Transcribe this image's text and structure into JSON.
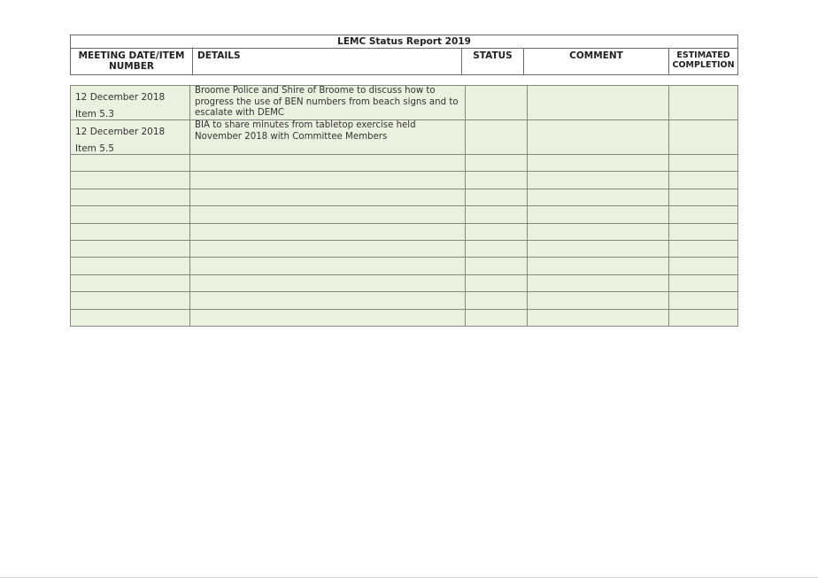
{
  "report": {
    "title": "LEMC Status Report 2019",
    "columns": {
      "meeting": "MEETING DATE/ITEM NUMBER",
      "details": "DETAILS",
      "status": "STATUS",
      "comment": "COMMENT",
      "estimated": "ESTIMATED COMPLETION"
    },
    "rows": [
      {
        "date": "12 December 2018",
        "item": "Item 5.3",
        "details": "Broome Police and Shire of Broome to discuss how to progress the use of BEN numbers from beach signs and to escalate with DEMC",
        "status": "",
        "comment": "",
        "estimated": ""
      },
      {
        "date": "12 December 2018",
        "item": "Item 5.5",
        "details": "BIA to share minutes from tabletop exercise held November 2018 with Committee Members",
        "status": "",
        "comment": "",
        "estimated": ""
      }
    ]
  }
}
